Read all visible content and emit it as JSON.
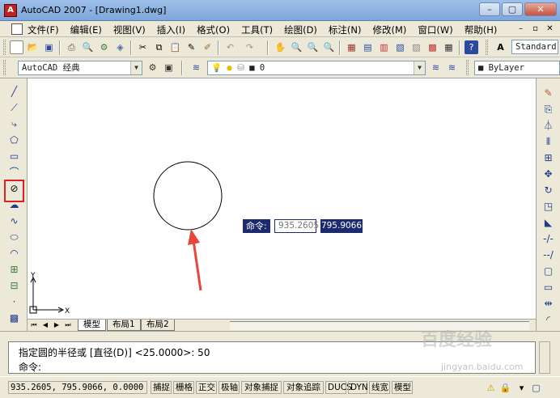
{
  "window": {
    "title": "AutoCAD 2007 - [Drawing1.dwg]",
    "app_icon": "autocad-logo-icon",
    "minimize": "–",
    "restore": "▢",
    "close": "✕"
  },
  "menubar": {
    "items": [
      "文件(F)",
      "编辑(E)",
      "视图(V)",
      "插入(I)",
      "格式(O)",
      "工具(T)",
      "绘图(D)",
      "标注(N)",
      "修改(M)",
      "窗口(W)",
      "帮助(H)"
    ],
    "doc_minimize": "–",
    "doc_restore": "▫",
    "doc_close": "✕"
  },
  "toolbar_standard": {
    "text_style": "Standard"
  },
  "toolbar_workspace": {
    "workspace": "AutoCAD 经典",
    "layer": "0",
    "color": "ByLayer"
  },
  "left_tools": {
    "icons": [
      "line-icon",
      "construction-line-icon",
      "polyline-icon",
      "polygon-icon",
      "rectangle-icon",
      "arc-icon",
      "circle-icon",
      "revision-cloud-icon",
      "spline-icon",
      "ellipse-icon",
      "ellipse-arc-icon",
      "insert-block-icon",
      "make-block-icon",
      "point-icon",
      "hatch-icon"
    ],
    "selected": "circle-icon"
  },
  "right_tools": {
    "icons": [
      "erase-icon",
      "copy-icon",
      "mirror-icon",
      "offset-icon",
      "array-icon",
      "move-icon",
      "rotate-icon",
      "scale-icon",
      "stretch-icon",
      "trim-icon",
      "extend-icon",
      "break-icon",
      "join-icon",
      "chamfer-icon",
      "fillet-icon"
    ]
  },
  "dynamic_input": {
    "label": "命令:",
    "x_value": "935.2605",
    "y_value": "795.9066"
  },
  "ucs": {
    "x_label": "X",
    "y_label": "Y"
  },
  "layout_tabs": [
    "模型",
    "布局1",
    "布局2"
  ],
  "command": {
    "line1": "指定圆的半径或 [直径(D)] <25.0000>: 50",
    "line2": "命令:"
  },
  "status": {
    "coords": "935.2605, 795.9066, 0.0000",
    "toggles": [
      "捕捉",
      "栅格",
      "正交",
      "极轴",
      "对象捕捉",
      "对象追踪",
      "DUCS",
      "DYN",
      "线宽",
      "模型"
    ]
  },
  "watermark": {
    "text": "百度经验",
    "url": "jingyan.baidu.com"
  },
  "colors": {
    "highlight": "#e02020",
    "dyn_bg": "#1c2a6e",
    "arrow": "#e8453c"
  }
}
